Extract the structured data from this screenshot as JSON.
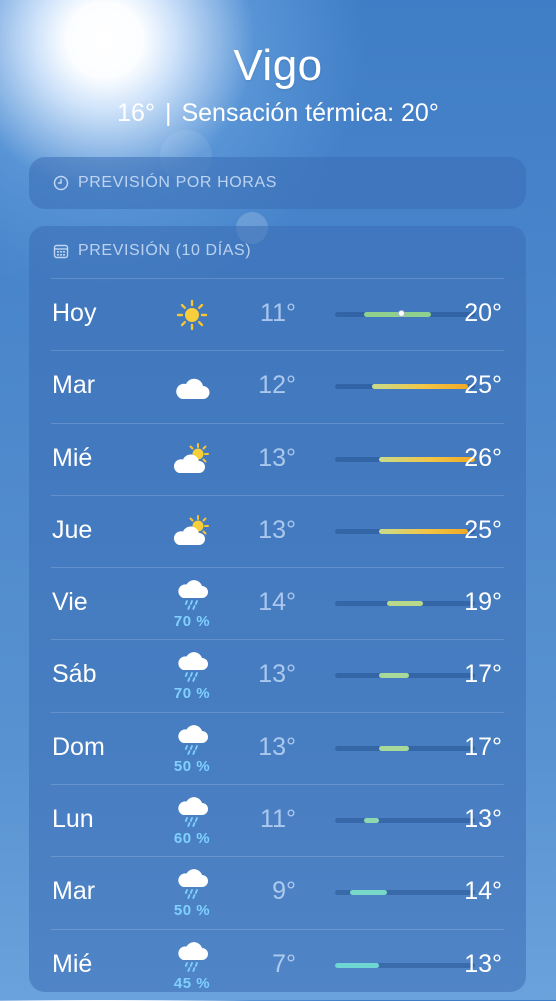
{
  "header": {
    "city": "Vigo",
    "current_temp": "16°",
    "separator": "|",
    "feels_like": "Sensación térmica: 20°"
  },
  "hourly_card": {
    "title": "PREVISIÓN POR HORAS",
    "icon": "clock-icon"
  },
  "daily_card": {
    "title": "PREVISIÓN (10 DÍAS)",
    "icon": "calendar-icon",
    "range_scale": {
      "min": 7,
      "max": 26
    },
    "current_temp_value": 16,
    "days": [
      {
        "day": "Hoy",
        "icon": "sun-icon",
        "precip": "",
        "low": "11°",
        "high": "20°",
        "low_val": 11,
        "high_val": 20,
        "color": "#8fd08f"
      },
      {
        "day": "Mar",
        "icon": "cloud-icon",
        "precip": "",
        "low": "12°",
        "high": "25°",
        "low_val": 12,
        "high_val": 25,
        "color": "gradient-warm"
      },
      {
        "day": "Mié",
        "icon": "partly-sunny-icon",
        "precip": "",
        "low": "13°",
        "high": "26°",
        "low_val": 13,
        "high_val": 26,
        "color": "gradient-warm"
      },
      {
        "day": "Jue",
        "icon": "partly-sunny-icon",
        "precip": "",
        "low": "13°",
        "high": "25°",
        "low_val": 13,
        "high_val": 25,
        "color": "gradient-warm"
      },
      {
        "day": "Vie",
        "icon": "rain-icon",
        "precip": "70 %",
        "low": "14°",
        "high": "19°",
        "low_val": 14,
        "high_val": 19,
        "color": "#b9d98a"
      },
      {
        "day": "Sáb",
        "icon": "rain-icon",
        "precip": "70 %",
        "low": "13°",
        "high": "17°",
        "low_val": 13,
        "high_val": 17,
        "color": "#a8d89a"
      },
      {
        "day": "Dom",
        "icon": "rain-icon",
        "precip": "50 %",
        "low": "13°",
        "high": "17°",
        "low_val": 13,
        "high_val": 17,
        "color": "#a8d89a"
      },
      {
        "day": "Lun",
        "icon": "rain-icon",
        "precip": "60 %",
        "low": "11°",
        "high": "13°",
        "low_val": 11,
        "high_val": 13,
        "color": "#8fd8b0"
      },
      {
        "day": "Mar",
        "icon": "rain-icon",
        "precip": "50 %",
        "low": "9°",
        "high": "14°",
        "low_val": 9,
        "high_val": 14,
        "color": "#78d8c8"
      },
      {
        "day": "Mié",
        "icon": "rain-icon",
        "precip": "45 %",
        "low": "7°",
        "high": "13°",
        "low_val": 7,
        "high_val": 13,
        "color": "#70d6d4"
      }
    ]
  }
}
